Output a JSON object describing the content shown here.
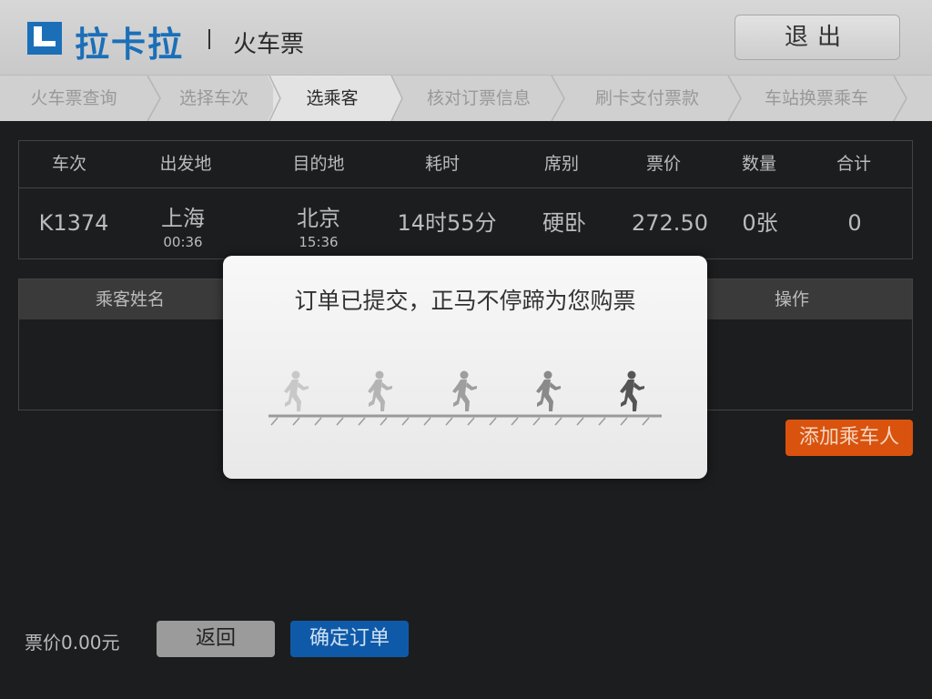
{
  "header": {
    "brand": "拉卡拉",
    "app_title": "火车票",
    "logout_label": "退出"
  },
  "steps": [
    {
      "label": "火车票查询",
      "active": false
    },
    {
      "label": "选择车次",
      "active": false
    },
    {
      "label": "选乘客",
      "active": true
    },
    {
      "label": "核对订票信息",
      "active": false
    },
    {
      "label": "刷卡支付票款",
      "active": false
    },
    {
      "label": "车站换票乘车",
      "active": false
    }
  ],
  "train_table": {
    "headers": [
      "车次",
      "出发地",
      "目的地",
      "耗时",
      "席别",
      "票价",
      "数量",
      "合计"
    ],
    "row": {
      "train_no": "K1374",
      "from_city": "上海",
      "from_time": "00:36",
      "to_city": "北京",
      "to_time": "15:36",
      "duration": "14时55分",
      "seat": "硬卧",
      "price": "272.50",
      "quantity": "0张",
      "total": "0"
    }
  },
  "passenger_table": {
    "col_name": "乘客姓名",
    "col_action": "操作"
  },
  "add_passenger_label": "添加乘车人",
  "footer": {
    "price_text": "票价0.00元",
    "back_label": "返回",
    "confirm_label": "确定订单"
  },
  "modal": {
    "message": "订单已提交，正马不停蹄为您购票"
  },
  "colors": {
    "brand_blue": "#1b6fb8",
    "accent_orange": "#d9530e",
    "confirm_blue": "#0f5aa8"
  }
}
